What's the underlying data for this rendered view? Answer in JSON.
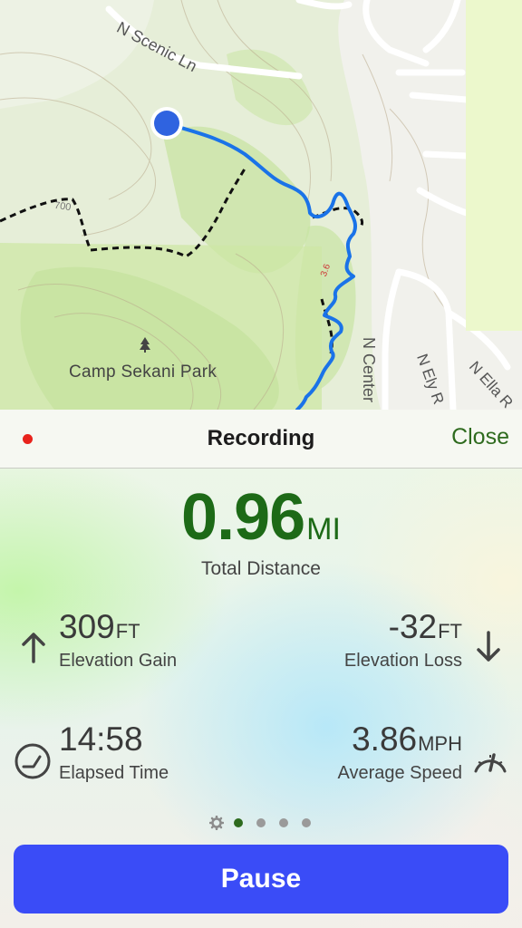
{
  "map": {
    "park_name": "Camp Sekani Park",
    "streets": {
      "scenic": "N Scenic Ln",
      "center": "N Center",
      "ely": "N Ely R",
      "ella_south": "N Ella R"
    },
    "trail_number": "700",
    "route_marker": "3.6",
    "icons": {
      "park": "tree-icon",
      "location": "current-location-icon"
    },
    "colors": {
      "route": "#1a73e8",
      "park_fill": "#cfe6a8",
      "terrain": "#e3ecd3",
      "trail_dash": "#111111"
    }
  },
  "recording": {
    "title": "Recording",
    "close_label": "Close",
    "status_color": "#e8231c"
  },
  "distance": {
    "value": "0.96",
    "unit": "MI",
    "label": "Total Distance"
  },
  "stats": {
    "elevation_gain": {
      "value": "309",
      "unit": "FT",
      "label": "Elevation Gain",
      "icon": "arrow-up-icon"
    },
    "elevation_loss": {
      "value": "-32",
      "unit": "FT",
      "label": "Elevation Loss",
      "icon": "arrow-down-icon"
    },
    "elapsed_time": {
      "value": "14:58",
      "label": "Elapsed Time",
      "icon": "clock-icon"
    },
    "average_speed": {
      "value": "3.86",
      "unit": "MPH",
      "label": "Average Speed",
      "icon": "gauge-icon"
    }
  },
  "pager": {
    "pages": 4,
    "active_index": 0,
    "settings_icon": "gear-icon"
  },
  "pause_label": "Pause",
  "accent_colors": {
    "green": "#1d6a17",
    "button": "#3a4cf7"
  }
}
